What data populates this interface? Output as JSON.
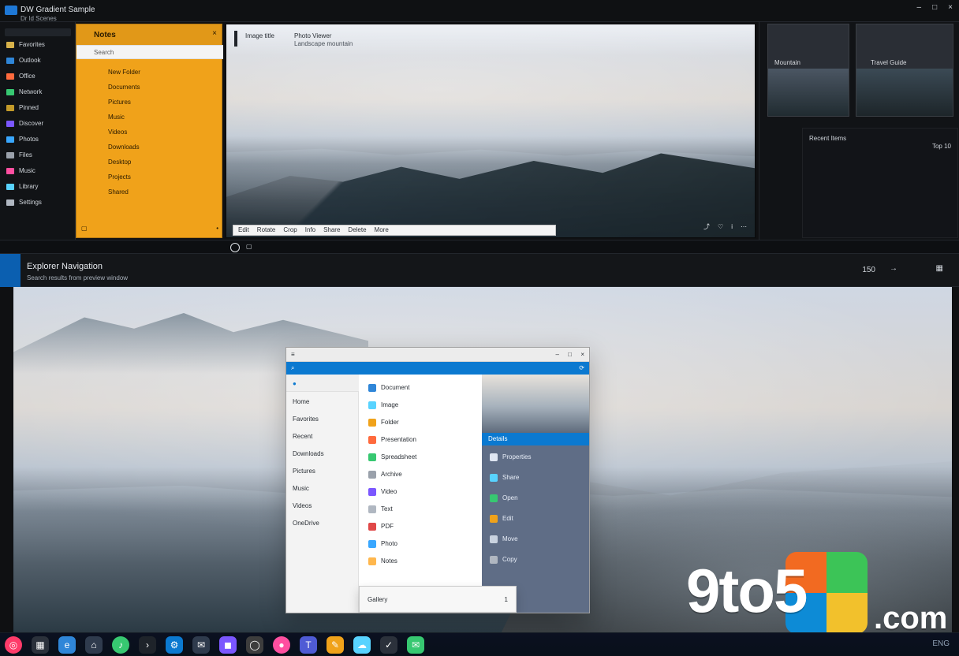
{
  "top_window": {
    "title": "DW Gradient Sample",
    "subtitle": "Dr ld Scenes",
    "controls": [
      "–",
      "□",
      "×"
    ]
  },
  "left_sidebar": {
    "items": [
      "Favorites",
      "Outlook",
      "Office",
      "Network",
      "Pinned",
      "Discover",
      "Photos",
      "Files",
      "Music",
      "Library",
      "Settings"
    ]
  },
  "orange_panel": {
    "title": "Notes",
    "search_placeholder": "Search",
    "items": [
      "New Folder",
      "Documents",
      "Pictures",
      "Music",
      "Videos",
      "Downloads",
      "Desktop",
      "Projects",
      "Shared"
    ]
  },
  "photo_viewer": {
    "header_left": "Image title",
    "header_right": "Photo Viewer",
    "header_right_sub": "Landscape mountain",
    "toolbar": {
      "labels": [
        "Edit",
        "Rotate",
        "Crop",
        "Info",
        "Share",
        "Delete",
        "More"
      ]
    }
  },
  "right_widgets": {
    "card1": "Mountain",
    "card2": "Travel Guide",
    "list_title": "Recent Items",
    "list_right": "Top 10"
  },
  "bottom_window": {
    "title": "Explorer Navigation",
    "subtitle": "Search results from preview window",
    "right_number": "150",
    "right_icons": [
      "back-icon",
      "forward-icon",
      "grid-icon"
    ]
  },
  "center_app": {
    "search_value": "",
    "left_pane_items": [
      "Home",
      "Favorites",
      "Recent",
      "Downloads",
      "Pictures",
      "Music",
      "Videos",
      "OneDrive"
    ],
    "mid_pane_items": [
      "Document",
      "Image",
      "Folder",
      "Presentation",
      "Spreadsheet",
      "Archive",
      "Video",
      "Text",
      "PDF",
      "Photo",
      "Notes"
    ],
    "right_pane_header": "Details",
    "right_pane_items": [
      "Properties",
      "Share",
      "Open",
      "Edit",
      "Move",
      "Copy"
    ],
    "bottom_popup": {
      "left": "Gallery",
      "right": "1"
    }
  },
  "taskbar": {
    "icons": [
      "start-icon",
      "files-icon",
      "edge-icon",
      "store-icon",
      "spotify-icon",
      "terminal-icon",
      "settings-icon",
      "mail-icon",
      "photos-icon",
      "browser-icon",
      "camera-icon",
      "teams-icon",
      "notes-icon",
      "weather-icon",
      "tasks-icon",
      "chat-icon"
    ],
    "right_text": "ENG"
  },
  "watermark": {
    "brand": "9to5",
    "suffix": ".com"
  }
}
